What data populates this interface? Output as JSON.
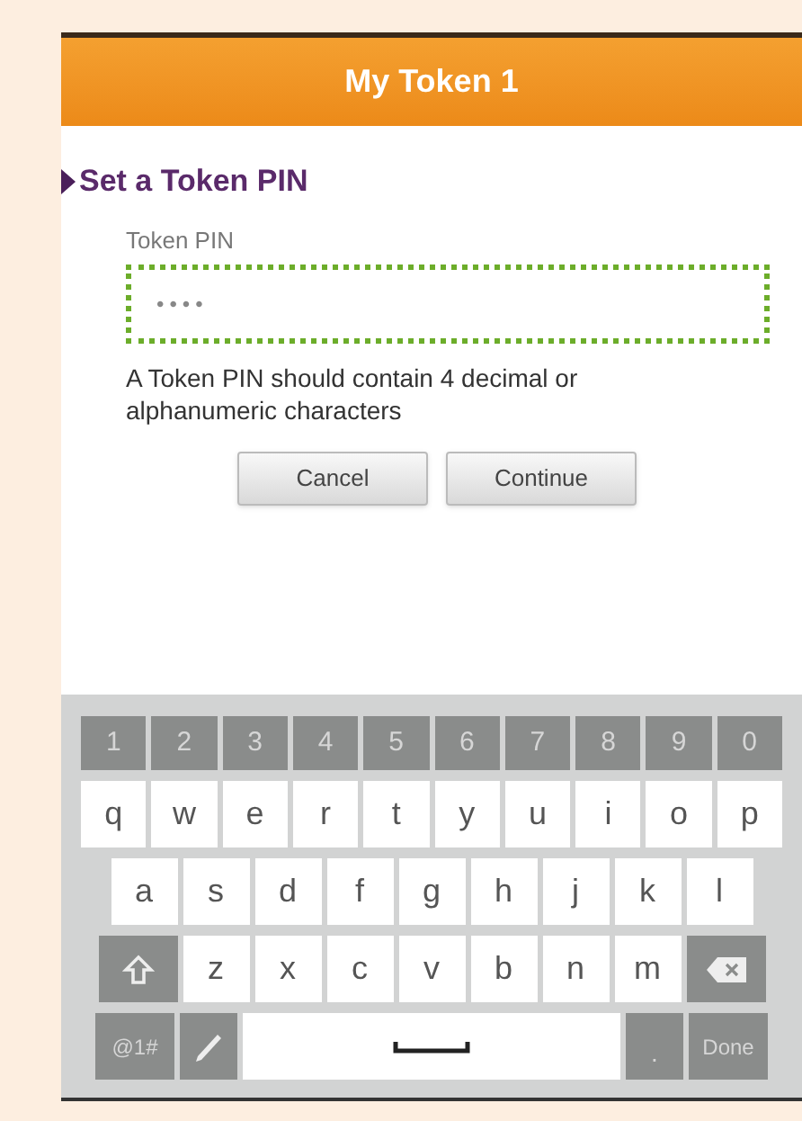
{
  "header": {
    "title": "My Token 1"
  },
  "section": {
    "title": "Set a Token PIN",
    "expanded": true
  },
  "pin_field": {
    "label": "Token PIN",
    "value": "••••",
    "focused": true
  },
  "hint": "A Token PIN should contain 4 decimal or alphanumeric characters",
  "buttons": [
    {
      "label": "Cancel"
    },
    {
      "label": "Continue"
    }
  ],
  "keyboard": {
    "number_keys": [
      {
        "kind": "number",
        "label": "1"
      },
      {
        "kind": "number",
        "label": "2"
      },
      {
        "kind": "number",
        "label": "3"
      },
      {
        "kind": "number",
        "label": "4"
      },
      {
        "kind": "number",
        "label": "5"
      },
      {
        "kind": "number",
        "label": "6"
      },
      {
        "kind": "number",
        "label": "7"
      },
      {
        "kind": "number",
        "label": "8"
      },
      {
        "kind": "number",
        "label": "9"
      },
      {
        "kind": "number",
        "label": "0"
      }
    ],
    "top_letter_keys": [
      {
        "kind": "letter",
        "label": "q"
      },
      {
        "kind": "letter",
        "label": "w"
      },
      {
        "kind": "letter",
        "label": "e"
      },
      {
        "kind": "letter",
        "label": "r"
      },
      {
        "kind": "letter",
        "label": "t"
      },
      {
        "kind": "letter",
        "label": "y"
      },
      {
        "kind": "letter",
        "label": "u"
      },
      {
        "kind": "letter",
        "label": "i"
      },
      {
        "kind": "letter",
        "label": "o"
      },
      {
        "kind": "letter",
        "label": "p"
      }
    ],
    "middle_letter_keys": [
      {
        "kind": "letter",
        "label": "a"
      },
      {
        "kind": "letter",
        "label": "s"
      },
      {
        "kind": "letter",
        "label": "d"
      },
      {
        "kind": "letter",
        "label": "f"
      },
      {
        "kind": "letter",
        "label": "g"
      },
      {
        "kind": "letter",
        "label": "h"
      },
      {
        "kind": "letter",
        "label": "j"
      },
      {
        "kind": "letter",
        "label": "k"
      },
      {
        "kind": "letter",
        "label": "l"
      }
    ],
    "bottom_letter_keys": [
      {
        "kind": "shift"
      },
      {
        "kind": "letter",
        "label": "z"
      },
      {
        "kind": "letter",
        "label": "x"
      },
      {
        "kind": "letter",
        "label": "c"
      },
      {
        "kind": "letter",
        "label": "v"
      },
      {
        "kind": "letter",
        "label": "b"
      },
      {
        "kind": "letter",
        "label": "n"
      },
      {
        "kind": "letter",
        "label": "m"
      },
      {
        "kind": "backspace"
      }
    ],
    "function_keys": [
      {
        "kind": "symbols",
        "label": "@1#"
      },
      {
        "kind": "pen"
      },
      {
        "kind": "space"
      },
      {
        "kind": "period",
        "label": "."
      },
      {
        "kind": "done",
        "label": "Done"
      }
    ]
  }
}
